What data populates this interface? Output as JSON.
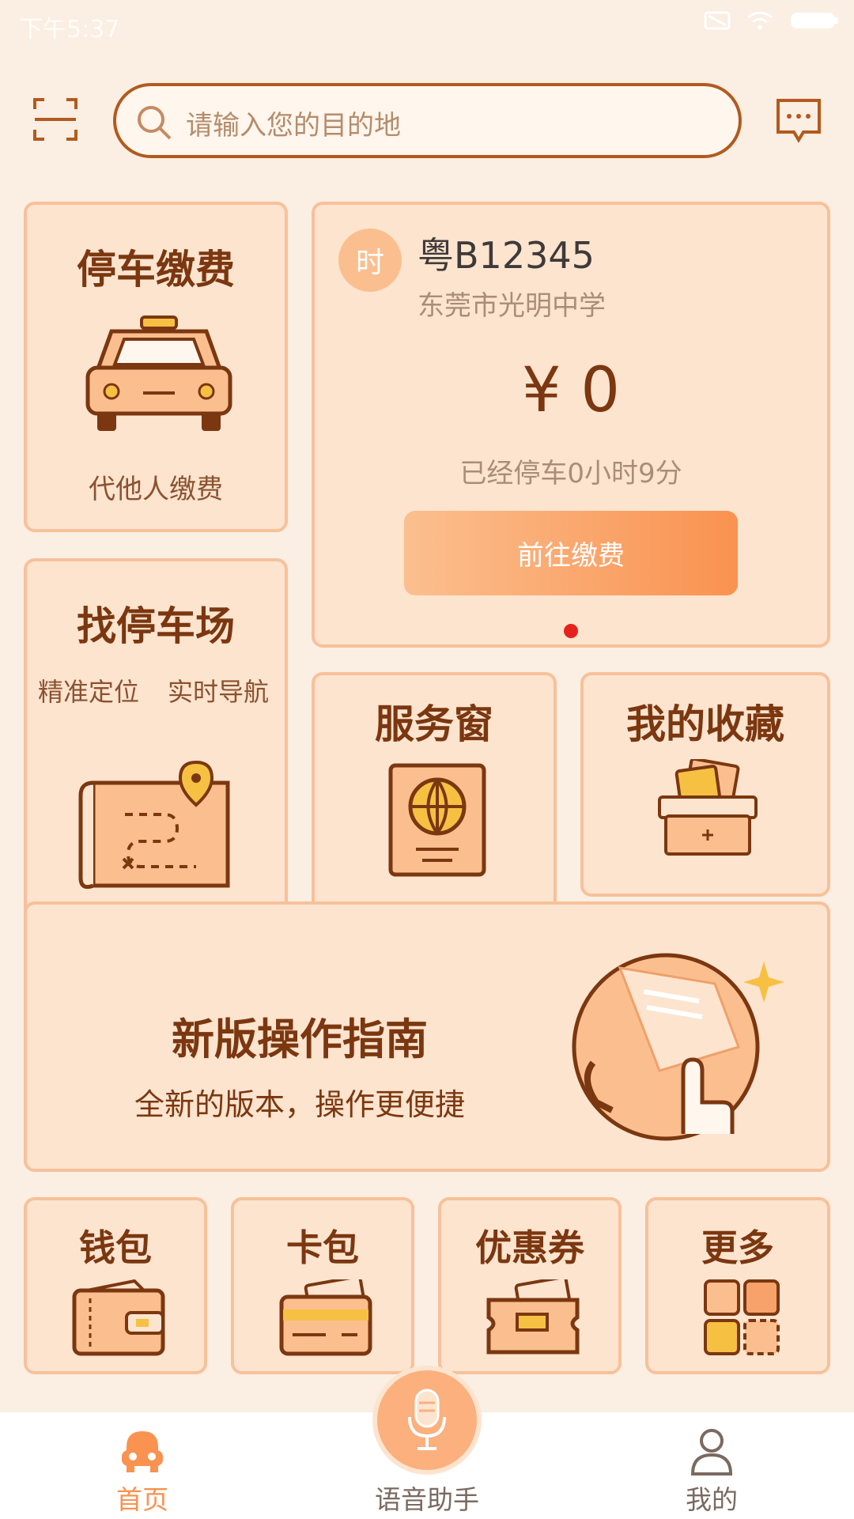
{
  "status": {
    "time": "下午5:37"
  },
  "search": {
    "placeholder": "请输入您的目的地"
  },
  "parking_pay": {
    "title": "停车缴费",
    "subtitle": "代他人缴费"
  },
  "current_parking": {
    "badge": "时",
    "plate": "粤B12345",
    "location": "东莞市光明中学",
    "amount": "¥ 0",
    "duration": "已经停车0小时9分",
    "pay_button": "前往缴费"
  },
  "find_parking": {
    "title": "找停车场",
    "features": [
      "精准定位",
      "实时导航"
    ]
  },
  "service_window": {
    "title": "服务窗"
  },
  "favorites": {
    "title": "我的收藏"
  },
  "guide": {
    "title": "新版操作指南",
    "subtitle": "全新的版本，操作更便捷"
  },
  "quick": [
    {
      "label": "钱包",
      "icon": "wallet-icon"
    },
    {
      "label": "卡包",
      "icon": "card-icon"
    },
    {
      "label": "优惠券",
      "icon": "coupon-icon"
    },
    {
      "label": "更多",
      "icon": "grid-icon"
    }
  ],
  "tabbar": {
    "home": "首页",
    "voice": "语音助手",
    "mine": "我的"
  },
  "colors": {
    "accent": "#fa9250",
    "brown": "#7b3710",
    "card_bg": "#fde4cf",
    "border": "#f7c19b"
  }
}
